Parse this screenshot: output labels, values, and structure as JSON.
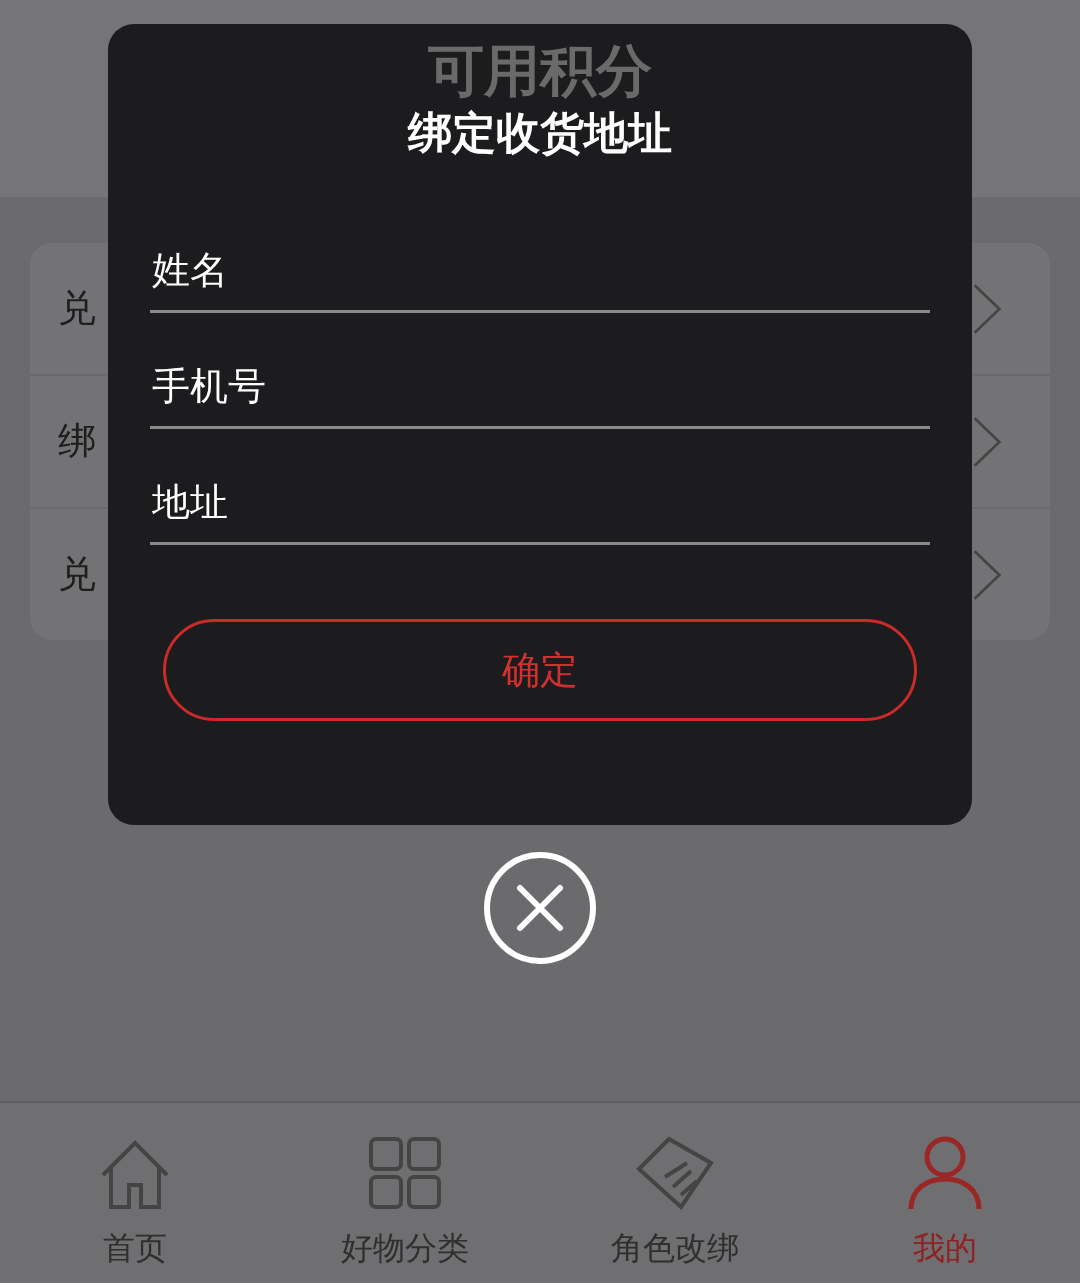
{
  "page": {
    "title": "可用积分"
  },
  "menu": [
    {
      "label": "兑"
    },
    {
      "label": "绑"
    },
    {
      "label": "兑"
    }
  ],
  "tab_bar": [
    {
      "label": "首页",
      "selected": false
    },
    {
      "label": "好物分类",
      "selected": false
    },
    {
      "label": "角色改绑",
      "selected": false
    },
    {
      "label": "我的",
      "selected": true
    }
  ],
  "dialog": {
    "title": "绑定收货地址",
    "fields": [
      {
        "placeholder": "姓名"
      },
      {
        "placeholder": "手机号"
      },
      {
        "placeholder": "地址"
      }
    ],
    "confirm_button": "确定"
  }
}
